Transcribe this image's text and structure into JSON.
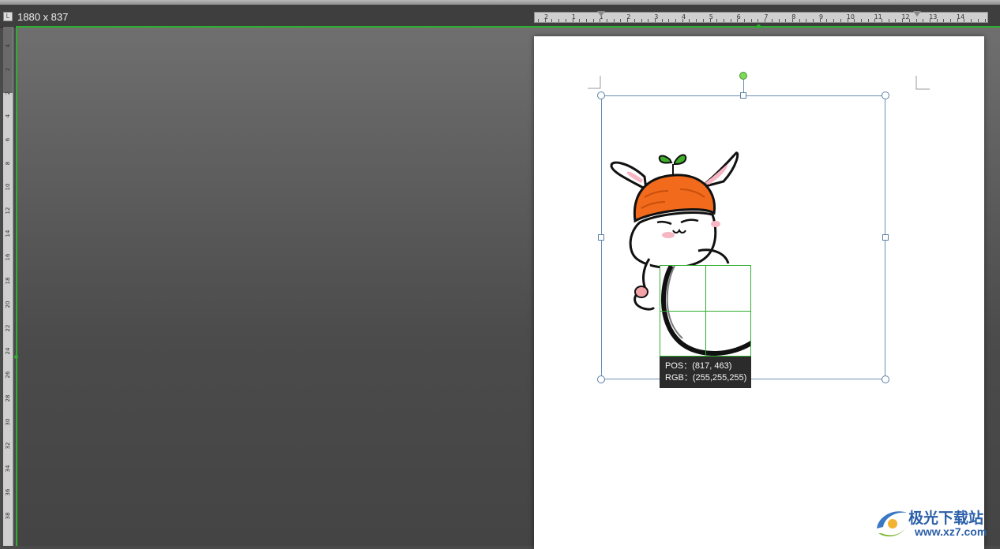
{
  "window": {
    "canvas_size_label": "1880 x 837",
    "ruler_corner_glyph": "L"
  },
  "rulers": {
    "horizontal_labels": [
      "2",
      "1",
      "1",
      "2",
      "3",
      "4",
      "5",
      "6",
      "7",
      "8",
      "9",
      "10",
      "11",
      "12",
      "13",
      "14"
    ],
    "vertical_labels": [
      "4",
      "2",
      "2",
      "4",
      "6",
      "8",
      "10",
      "12",
      "14",
      "16",
      "18",
      "20",
      "22",
      "24",
      "26",
      "28",
      "30",
      "32",
      "34",
      "36",
      "38"
    ]
  },
  "color_picker": {
    "pos_label": "POS：(817, 463)",
    "rgb_label": "RGB：(255,255,255)"
  },
  "colors": {
    "guide": "#2fae2f",
    "selection_border": "#6b8fb8",
    "carrot_hat": "#f26a1b",
    "leaf": "#3fae2a"
  },
  "watermark": {
    "title": "极光下载站",
    "url": "www.xz7.com"
  },
  "icons": [
    "corner-marker-icon",
    "rotate-handle-icon",
    "resize-handle-icon",
    "watermark-logo-icon"
  ]
}
